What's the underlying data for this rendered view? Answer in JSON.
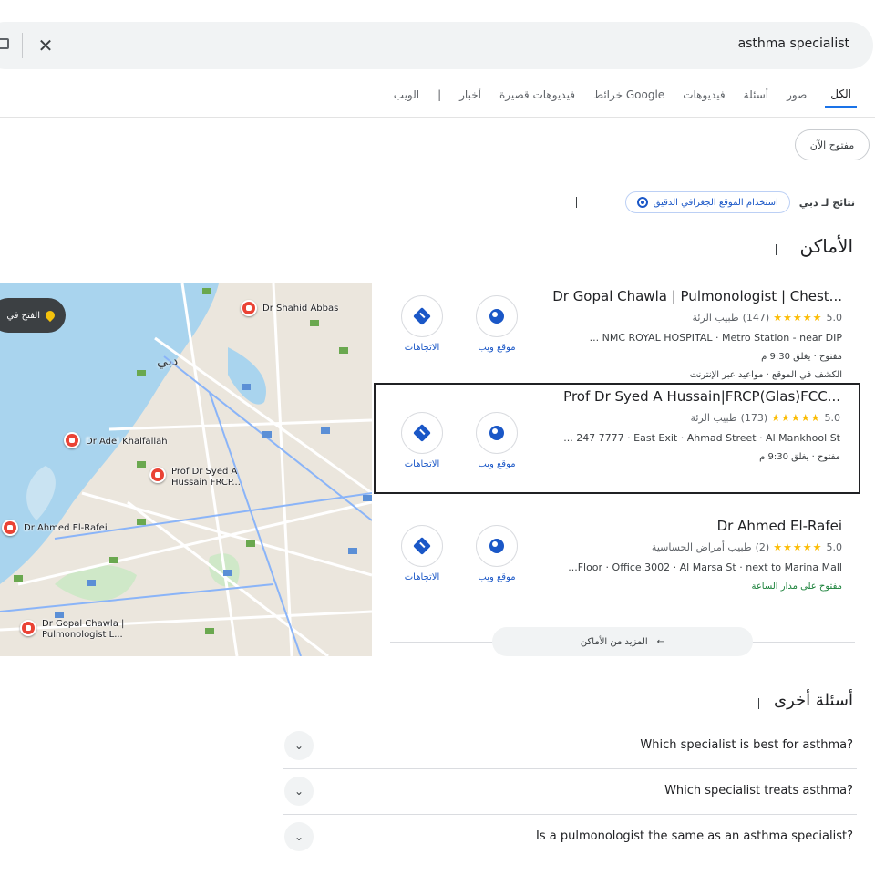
{
  "search": {
    "query": "asthma specialist",
    "clear_icon": "close-icon"
  },
  "tabs": [
    {
      "label": "الكل",
      "active": true
    },
    {
      "label": "صور"
    },
    {
      "label": "أسئلة"
    },
    {
      "label": "فيديوهات"
    },
    {
      "label": "خرائط Google"
    },
    {
      "label": "فيديوهات قصيرة"
    },
    {
      "label": "أخبار"
    },
    {
      "label": "الويب"
    }
  ],
  "chips": {
    "open_now": "مفتوح الآن"
  },
  "location": {
    "text": "نتائج لـ دبي",
    "button": "استخدام الموقع الجغرافي الدقيق"
  },
  "places": {
    "title": "الأماكن",
    "map_button": "الفتح في",
    "map_city": "دبي",
    "map_labels": [
      "Dr Shahid Abbas",
      "Dr Adel Khalfallah",
      "Prof Dr Syed A Hussain FRCP...",
      "Dr Ahmed El-Rafei",
      "Dr Gopal Chawla | Pulmonologist L..."
    ],
    "results": [
      {
        "name": "Dr Gopal Chawla | Pulmonologist | Chest...",
        "rating": "5.0",
        "stars": "★★★★★",
        "reviews": "(147)",
        "category": "طبيب الرئة",
        "address": "... NMC ROYAL HOSPITAL · Metro Station - near DIP",
        "hours": "مفتوح · يغلق 9:30 م",
        "extra": "الكشف في الموقع · مواعيد عبر الإنترنت",
        "website": "موقع ويب",
        "directions": "الاتجاهات"
      },
      {
        "name": "Prof Dr Syed A Hussain|FRCP(Glas)FCC...",
        "rating": "5.0",
        "stars": "★★★★★",
        "reviews": "(173)",
        "category": "طبيب الرئة",
        "address": "... 247 7777 · East Exit · Ahmad Street · Al Mankhool St",
        "hours": "مفتوح · يغلق 9:30 م",
        "extra": "",
        "website": "موقع ويب",
        "directions": "الاتجاهات"
      },
      {
        "name": "Dr Ahmed El-Rafei",
        "rating": "5.0",
        "stars": "★★★★★",
        "reviews": "(2)",
        "category": "طبيب أمراض الحساسية",
        "address": "...Floor · Office 3002 · Al Marsa St · next to Marina Mall",
        "hours": "مفتوح على مدار الساعة",
        "extra": "",
        "website": "موقع ويب",
        "directions": "الاتجاهات"
      }
    ],
    "more": "المزيد من الأماكن"
  },
  "faq": {
    "title": "أسئلة أخرى",
    "questions": [
      "Which specialist is best for asthma?",
      "Which specialist treats asthma?",
      "Is a pulmonologist the same as an asthma specialist?"
    ]
  }
}
